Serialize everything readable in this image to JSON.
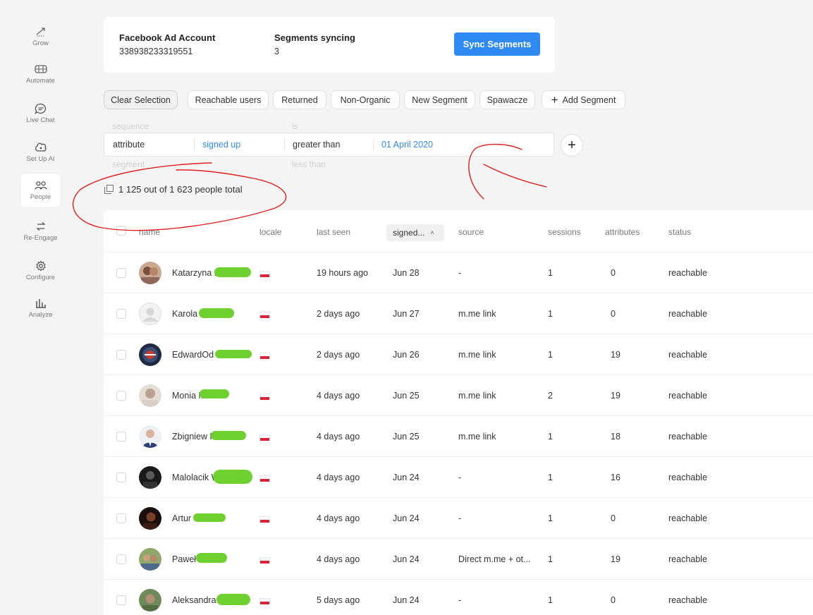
{
  "sidebar": {
    "items": [
      {
        "label": "Grow",
        "icon": "trend-up-icon"
      },
      {
        "label": "Automate",
        "icon": "workflow-icon"
      },
      {
        "label": "Live Chat",
        "icon": "chat-icon"
      },
      {
        "label": "Set Up AI",
        "icon": "ai-brain-icon"
      },
      {
        "label": "People",
        "icon": "people-icon",
        "active": true
      },
      {
        "label": "Re-Engage",
        "icon": "swap-arrows-icon"
      },
      {
        "label": "Configure",
        "icon": "gear-icon"
      },
      {
        "label": "Analyze",
        "icon": "bar-chart-icon"
      }
    ]
  },
  "account": {
    "account_label": "Facebook Ad Account",
    "account_id": "338938233319551",
    "segments_label": "Segments syncing",
    "segments_count": "3",
    "sync_button": "Sync Segments"
  },
  "segments": {
    "chips": [
      "Clear Selection",
      "Reachable users",
      "Returned",
      "Non-Organic",
      "New Segment",
      "Spawacze"
    ],
    "add_label": "Add Segment"
  },
  "filter": {
    "ghost_above_field": "sequence",
    "ghost_above_operator": "is",
    "field": "attribute",
    "attribute": "signed up",
    "operator": "greater than",
    "value": "01 April 2020",
    "ghost_below_field": "segment",
    "ghost_below_operator": "less than"
  },
  "summary": {
    "count_text": "1 125 out of 1 623 people total"
  },
  "table": {
    "headers": {
      "name": "name",
      "locale": "locale",
      "last_seen": "last seen",
      "signed": "signed...",
      "source": "source",
      "sessions": "sessions",
      "attributes": "attributes",
      "status": "status"
    },
    "rows": [
      {
        "name": "Katarzyna B",
        "last_seen": "19 hours ago",
        "signed": "Jun 28",
        "source": "-",
        "sessions": "1",
        "attributes": "0",
        "status": "reachable"
      },
      {
        "name": "Karola K",
        "last_seen": "2 days ago",
        "signed": "Jun 27",
        "source": "m.me link",
        "sessions": "1",
        "attributes": "0",
        "status": "reachable"
      },
      {
        "name": "EdwardOd N...",
        "last_seen": "2 days ago",
        "signed": "Jun 26",
        "source": "m.me link",
        "sessions": "1",
        "attributes": "19",
        "status": "reachable"
      },
      {
        "name": "Monia M",
        "last_seen": "4 days ago",
        "signed": "Jun 25",
        "source": "m.me link",
        "sessions": "2",
        "attributes": "19",
        "status": "reachable"
      },
      {
        "name": "Zbigniew K",
        "last_seen": "4 days ago",
        "signed": "Jun 25",
        "source": "m.me link",
        "sessions": "1",
        "attributes": "18",
        "status": "reachable"
      },
      {
        "name": "Malolacik W",
        "last_seen": "4 days ago",
        "signed": "Jun 24",
        "source": "-",
        "sessions": "1",
        "attributes": "16",
        "status": "reachable"
      },
      {
        "name": "Artur",
        "last_seen": "4 days ago",
        "signed": "Jun 24",
        "source": "-",
        "sessions": "1",
        "attributes": "0",
        "status": "reachable"
      },
      {
        "name": "Paweł S",
        "last_seen": "4 days ago",
        "signed": "Jun 24",
        "source": "Direct m.me + ot...",
        "sessions": "1",
        "attributes": "19",
        "status": "reachable"
      },
      {
        "name": "Aleksandra M",
        "last_seen": "5 days ago",
        "signed": "Jun 24",
        "source": "-",
        "sessions": "1",
        "attributes": "0",
        "status": "reachable"
      }
    ]
  },
  "colors": {
    "accent": "#2f8af3",
    "annotation": "#e02020",
    "redaction": "#6fd12f",
    "flag_red": "#d9253a"
  }
}
